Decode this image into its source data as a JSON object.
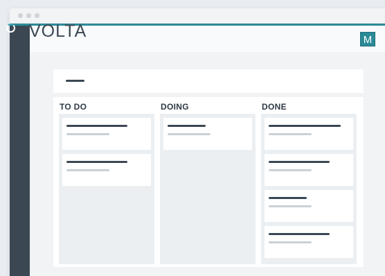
{
  "app": {
    "logo_text": "VOLTA",
    "avatar_initial": "M",
    "accent_color": "#2b8a97",
    "sidebar_color": "#3b4753"
  },
  "board": {
    "columns": [
      {
        "title": "TO DO",
        "card_count": 2
      },
      {
        "title": "DOING",
        "card_count": 1
      },
      {
        "title": "DONE",
        "card_count": 4
      }
    ]
  },
  "icons": [
    "loading-spinner-icon"
  ]
}
